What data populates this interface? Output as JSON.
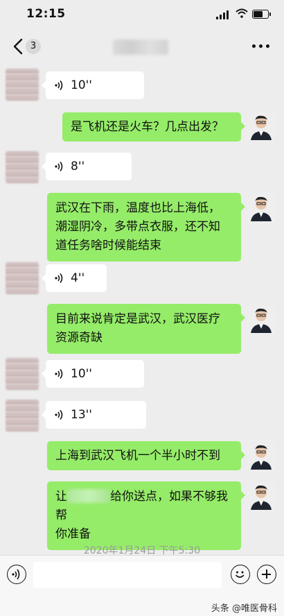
{
  "status_bar": {
    "time": "12:15"
  },
  "header": {
    "unread_count": "3"
  },
  "messages": [
    {
      "side": "left",
      "type": "voice",
      "duration": "10''"
    },
    {
      "side": "right",
      "type": "text",
      "text": "是飞机还是火车？几点出发？"
    },
    {
      "side": "left",
      "type": "voice",
      "duration": "8''"
    },
    {
      "side": "right",
      "type": "text",
      "lines": [
        "武汉在下雨，温度也比上海低，",
        "潮湿阴冷，多带点衣服，还不知",
        "道任务啥时候能结束"
      ]
    },
    {
      "side": "left",
      "type": "voice",
      "duration": "4''"
    },
    {
      "side": "right",
      "type": "text",
      "lines": [
        "目前来说肯定是武汉，武汉医疗",
        "资源奇缺"
      ]
    },
    {
      "side": "left",
      "type": "voice",
      "duration": "10''"
    },
    {
      "side": "left",
      "type": "voice",
      "duration": "13''"
    },
    {
      "side": "right",
      "type": "text",
      "text": "上海到武汉飞机一个半小时不到"
    },
    {
      "side": "right",
      "type": "text",
      "line1_prefix": "让",
      "line1_suffix": "给你送点，如果不够我帮",
      "line2": "你准备"
    }
  ],
  "timestamp": "2020年1月24日 下午5:30",
  "input_bar": {
    "placeholder": ""
  },
  "watermark": "头条 @唯医骨科",
  "colors": {
    "background": "#ededed",
    "sent_bubble": "#95ec69",
    "received_bubble": "#ffffff",
    "timestamp": "#9a9a9a"
  }
}
